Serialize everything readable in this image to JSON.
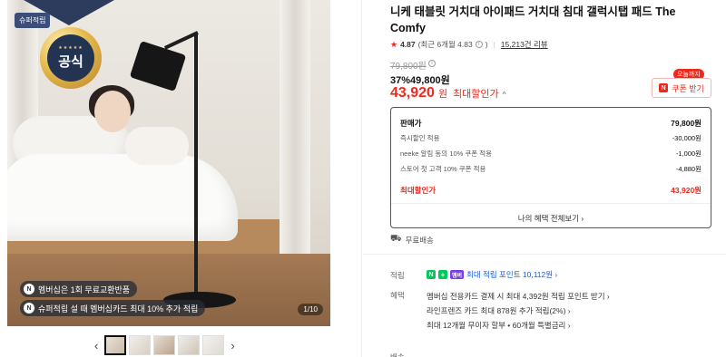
{
  "gallery": {
    "super_badge": "슈퍼적립",
    "official_badge": "공식",
    "medal_stars": "★★★★★",
    "pill1_icon": "N",
    "pill1": "멤버십은 1회 무료교환반품",
    "pill2_icon": "N",
    "pill2": "슈퍼적립 설 때 멤버십카드 최대 10% 추가 적립",
    "counter": "1/10",
    "prev_arrow": "‹",
    "next_arrow": "›"
  },
  "product": {
    "title": "니케 태블릿 거치대 아이패드 거치대 침대 갤럭시탭 패드 The Comfy",
    "rating": "4.87",
    "recent_rating": "(최근 6개월 4.83",
    "reviews": "15,213건 리뷰",
    "original_price": "79,800원",
    "discount_rate": "37%",
    "discount_price": "49,800원",
    "max_price": "43,920",
    "max_price_unit": "원",
    "max_label": "최대할인가",
    "coupon_tag": "오늘까지",
    "coupon_button": "쿠폰 받기"
  },
  "price_box": {
    "rows": [
      {
        "label": "판매가",
        "value": "79,800원"
      },
      {
        "label": "즉시할인 적용",
        "value": "-30,000원"
      },
      {
        "label": "neeke 알림 동의 10% 쿠폰 적용",
        "value": "-1,000원"
      },
      {
        "label": "스토어 첫 고객 10% 쿠폰 적용",
        "value": "-4,880원"
      }
    ],
    "max_label": "최대할인가",
    "max_value": "43,920원",
    "more": "나의 혜택 전체보기 ›"
  },
  "shipping": {
    "free": "무료배송",
    "label": "배송"
  },
  "points": {
    "label": "적립",
    "text": "최대 적립 포인트 10,112원 ›"
  },
  "benefits": {
    "label": "혜택",
    "items": [
      "멤버십 전용카드 결제 시 최대 4,392원 적립 포인트 받기 ›",
      "라인프렌즈 카드 최대 878원 추가 적립(2%) ›",
      "최대 12개월 무이자 할부 • 60개월 특별금리 ›"
    ]
  }
}
